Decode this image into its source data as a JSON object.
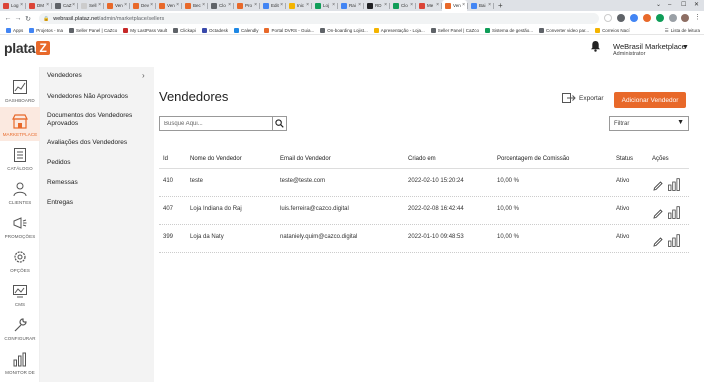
{
  "browser": {
    "tabs": [
      {
        "label": "Log",
        "color": "#db4437"
      },
      {
        "label": "DM",
        "color": "#db4437"
      },
      {
        "label": "CaZ",
        "color": "#5f6368"
      },
      {
        "label": "Sell",
        "color": "#cccccc"
      },
      {
        "label": "Ven",
        "color": "#e8692a"
      },
      {
        "label": "Dev",
        "color": "#e8692a"
      },
      {
        "label": "Ven",
        "color": "#e8692a"
      },
      {
        "label": "Bec",
        "color": "#e8692a"
      },
      {
        "label": "Clo",
        "color": "#5f6368"
      },
      {
        "label": "Pro",
        "color": "#e8692a"
      },
      {
        "label": "Edit",
        "color": "#4285f4"
      },
      {
        "label": "Inic",
        "color": "#f4b400"
      },
      {
        "label": "Loj",
        "color": "#0f9d58"
      },
      {
        "label": "Rai",
        "color": "#4285f4"
      },
      {
        "label": "RD",
        "color": "#202124"
      },
      {
        "label": "Clo",
        "color": "#0f9d58"
      },
      {
        "label": "Me",
        "color": "#db4437"
      },
      {
        "label": "Ven",
        "color": "#e8692a"
      },
      {
        "label": "Bai",
        "color": "#4285f4"
      }
    ],
    "new_tab": "+",
    "url_host": "webrasil.plataz.net",
    "url_path": "/admin/marketplace/sellers",
    "apps_label": "Apps",
    "bookmarks": [
      {
        "label": "Projetos - Ina",
        "color": "#4285f4"
      },
      {
        "label": "Seller Panel | CaZco",
        "color": "#5f6368"
      },
      {
        "label": "My LastPass Vault",
        "color": "#c62828"
      },
      {
        "label": "Clickapi",
        "color": "#5f6368"
      },
      {
        "label": "Octadesk",
        "color": "#3949ab"
      },
      {
        "label": "Calendly",
        "color": "#1e88e5"
      },
      {
        "label": "Portal DVRS - Guia...",
        "color": "#e8692a"
      },
      {
        "label": "On-boarding Lojist...",
        "color": "#5f6368"
      },
      {
        "label": "Apresentação - Loja...",
        "color": "#f4b400"
      },
      {
        "label": "Seller Panel | CaZco",
        "color": "#5f6368"
      },
      {
        "label": "Sistema de gestão...",
        "color": "#0f9d58"
      },
      {
        "label": "Converter video par...",
        "color": "#5f6368"
      },
      {
        "label": "Correios Nací",
        "color": "#f4b400"
      }
    ],
    "reading_list": "Lista de leitura"
  },
  "header": {
    "logo_text": "plata",
    "logo_mark": "Z",
    "user_name": "WeBrasil Marketplace",
    "user_role": "Administrator"
  },
  "rail": [
    {
      "label": "DASHBOARD",
      "icon": "dashboard-icon",
      "active": false
    },
    {
      "label": "MARKETPLACE",
      "icon": "marketplace-icon",
      "active": true
    },
    {
      "label": "CATÁLOGO",
      "icon": "catalog-icon",
      "active": false
    },
    {
      "label": "CLIENTES",
      "icon": "customers-icon",
      "active": false
    },
    {
      "label": "PROMOÇÕES",
      "icon": "promotions-icon",
      "active": false
    },
    {
      "label": "OPÇÕES",
      "icon": "options-icon",
      "active": false
    },
    {
      "label": "CMS",
      "icon": "cms-icon",
      "active": false
    },
    {
      "label": "CONFIGURAR",
      "icon": "configure-icon",
      "active": false
    },
    {
      "label": "MONITOR DE",
      "icon": "monitor-icon",
      "active": false
    }
  ],
  "subnav": [
    "Vendedores",
    "Vendedores Não Aprovados",
    "Documentos dos Vendedores Aprovados",
    "Avaliações dos Vendedores",
    "Pedidos",
    "Remessas",
    "Entregas"
  ],
  "main": {
    "title": "Vendedores",
    "export_label": "Exportar",
    "add_label": "Adicionar Vendedor",
    "search_placeholder": "Busque Aqui...",
    "filter_label": "Filtrar",
    "accent": "#e8692a",
    "columns": [
      "Id",
      "Nome do Vendedor",
      "Email do Vendedor",
      "Criado em",
      "Porcentagem de Comissão",
      "Status",
      "Ações"
    ],
    "rows": [
      {
        "id": "410",
        "name": "teste",
        "email": "teste@teste.com",
        "created": "2022-02-10 15:20:24",
        "commission": "10,00 %",
        "status": "Ativo"
      },
      {
        "id": "407",
        "name": "Loja Indiana do Raj",
        "email": "luis.ferreira@cazco.digital",
        "created": "2022-02-08 16:42:44",
        "commission": "10,00 %",
        "status": "Ativo"
      },
      {
        "id": "399",
        "name": "Loja da Naty",
        "email": "nataniely.quim@cazco.digital",
        "created": "2022-01-10 09:48:53",
        "commission": "10,00 %",
        "status": "Ativo"
      }
    ]
  }
}
